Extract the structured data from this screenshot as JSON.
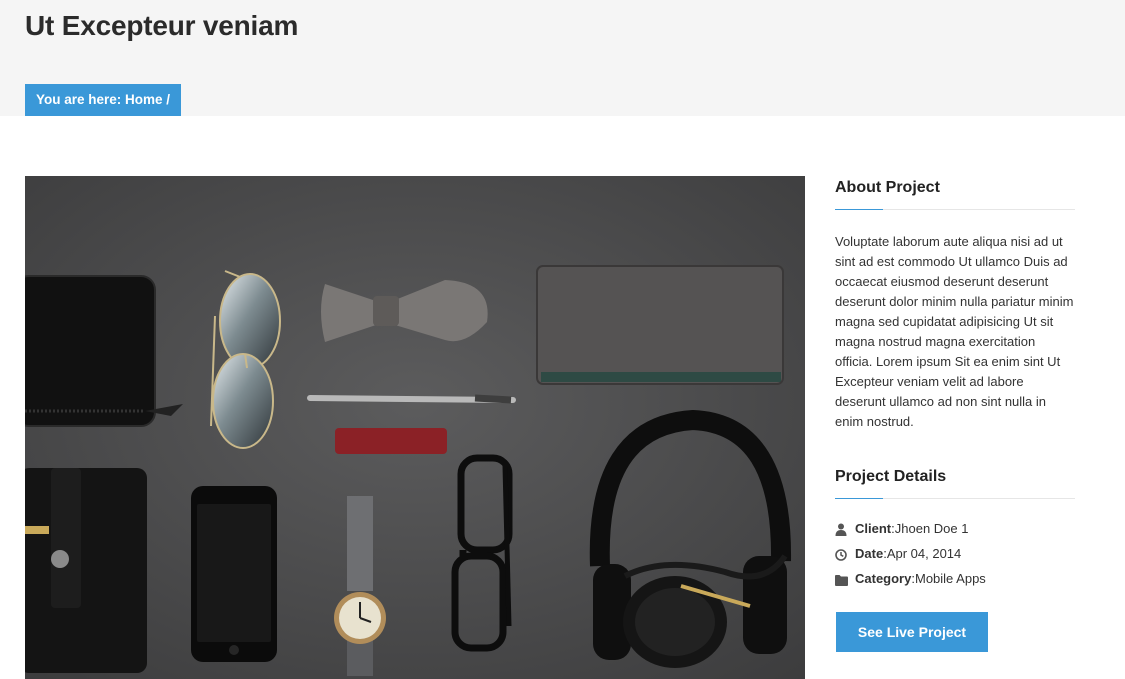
{
  "page": {
    "title": "Ut Excepteur veniam",
    "breadcrumb": {
      "prefix": "You are here: ",
      "home": "Home",
      "separator": " /"
    }
  },
  "about": {
    "title": "About Project",
    "text": "Voluptate laborum aute aliqua nisi ad ut sint ad est commodo Ut ullamco Duis ad occaecat eiusmod deserunt deserunt deserunt dolor minim nulla pariatur minim magna sed cupidatat adipisicing Ut sit magna nostrud magna exercitation officia. Lorem ipsum Sit ea enim sint Ut Excepteur veniam velit ad labore deserunt ullamco ad non sint nulla in enim nostrud."
  },
  "details": {
    "title": "Project Details",
    "items": [
      {
        "icon": "user-icon",
        "label": "Client",
        "value": "Jhoen Doe 1"
      },
      {
        "icon": "clock-icon",
        "label": "Date",
        "value": "Apr 04, 2014"
      },
      {
        "icon": "folder-icon",
        "label": "Category",
        "value": "Mobile Apps"
      }
    ],
    "button_label": "See Live Project"
  },
  "colors": {
    "accent": "#3a98d8",
    "header_bg": "#f5f5f5"
  }
}
